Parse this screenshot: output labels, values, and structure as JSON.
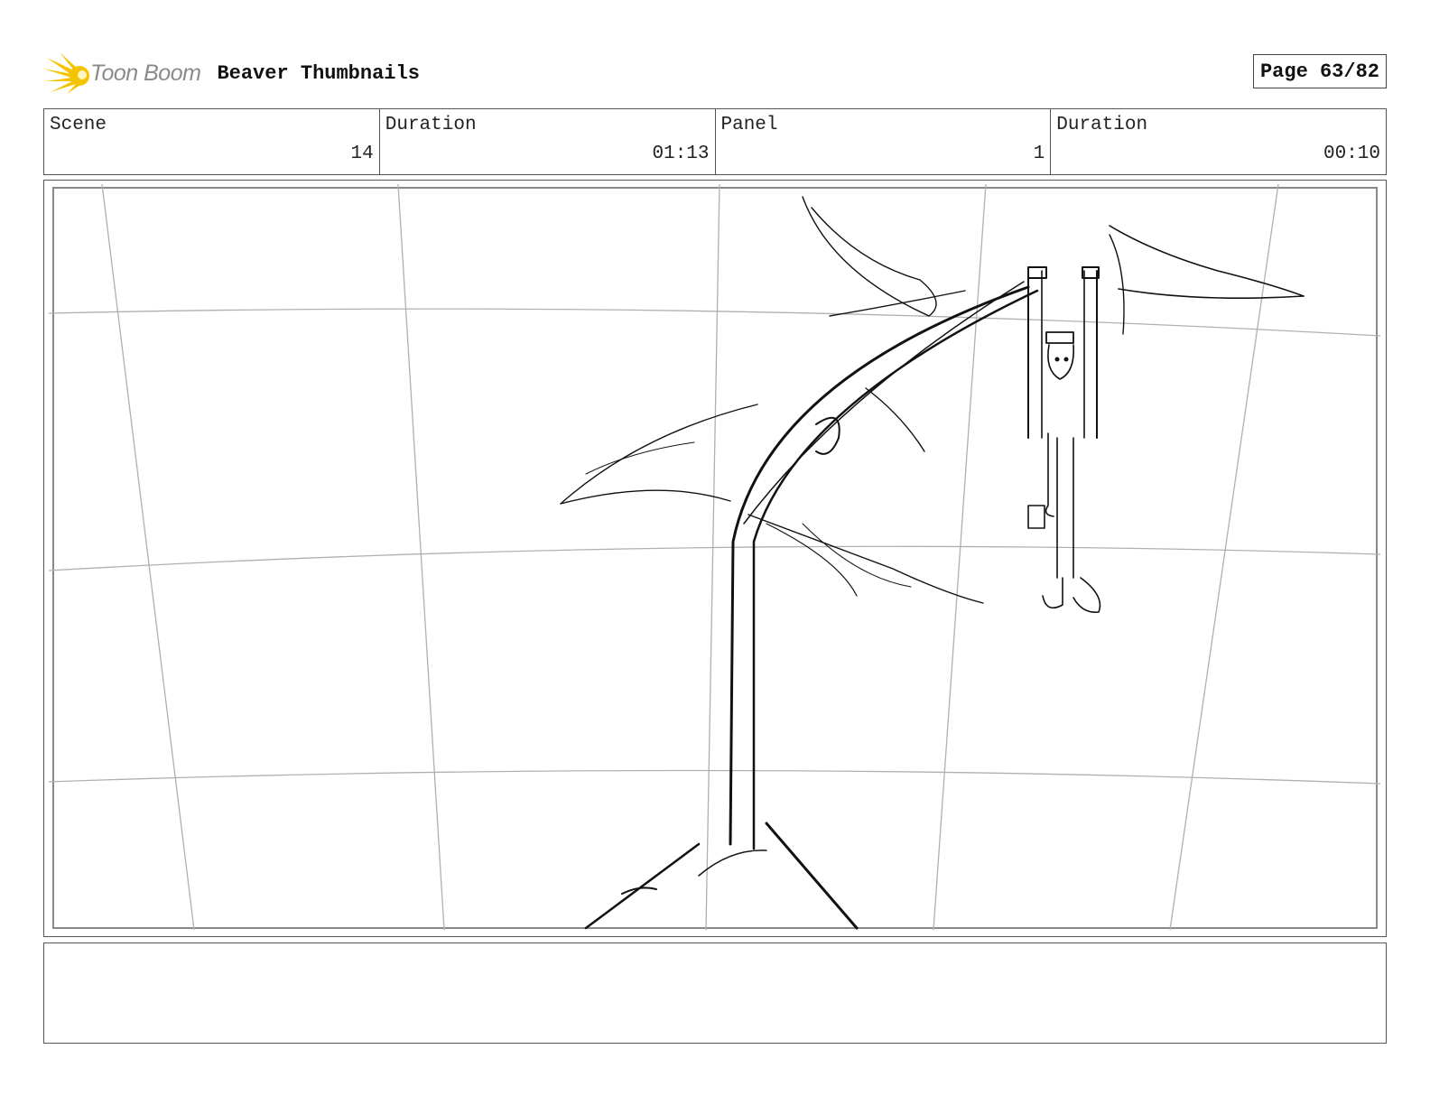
{
  "header": {
    "logo_text": "Toon Boom",
    "project_title": "Beaver Thumbnails",
    "page_label": "Page 63/82"
  },
  "info": {
    "scene_label": "Scene",
    "scene_value": "14",
    "scene_duration_label": "Duration",
    "scene_duration_value": "01:13",
    "panel_label": "Panel",
    "panel_value": "1",
    "panel_duration_label": "Duration",
    "panel_duration_value": "00:10"
  },
  "notes": {
    "text": ""
  },
  "colors": {
    "logo_yellow": "#f5c400",
    "logo_gray": "#8a8a8a",
    "border": "#555555",
    "guide_lines": "#b0b0b0",
    "sketch": "#111111"
  }
}
